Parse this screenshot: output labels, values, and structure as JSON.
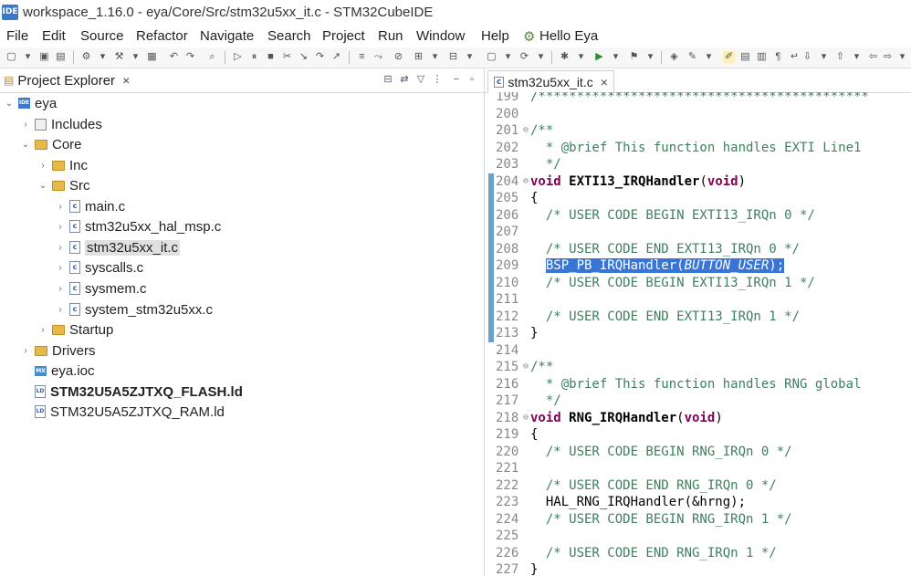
{
  "window": {
    "badge": "IDE",
    "title": "workspace_1.16.0 - eya/Core/Src/stm32u5xx_it.c - STM32CubeIDE"
  },
  "menu": [
    "File",
    "Edit",
    "Source",
    "Refactor",
    "Navigate",
    "Search",
    "Project",
    "Run",
    "Window",
    "Help",
    "Hello Eya"
  ],
  "explorer": {
    "title": "Project Explorer",
    "tree": [
      {
        "label": "eya",
        "twisty": "⌄",
        "icon": "project"
      },
      {
        "label": "Includes",
        "twisty": "›",
        "icon": "includes"
      },
      {
        "label": "Core",
        "twisty": "⌄",
        "icon": "folder"
      },
      {
        "label": "Inc",
        "twisty": "›",
        "icon": "folder"
      },
      {
        "label": "Src",
        "twisty": "⌄",
        "icon": "folder"
      },
      {
        "label": "main.c",
        "twisty": "›",
        "icon": "cfile"
      },
      {
        "label": "stm32u5xx_hal_msp.c",
        "twisty": "›",
        "icon": "cfile"
      },
      {
        "label": "stm32u5xx_it.c",
        "twisty": "›",
        "icon": "cfile",
        "selected": true
      },
      {
        "label": "syscalls.c",
        "twisty": "›",
        "icon": "cfile"
      },
      {
        "label": "sysmem.c",
        "twisty": "›",
        "icon": "cfile"
      },
      {
        "label": "system_stm32u5xx.c",
        "twisty": "›",
        "icon": "cfile"
      },
      {
        "label": "Startup",
        "twisty": "›",
        "icon": "folder"
      },
      {
        "label": "Drivers",
        "twisty": "›",
        "icon": "folder"
      },
      {
        "label": "eya.ioc",
        "twisty": "",
        "icon": "mx"
      },
      {
        "label": "STM32U5A5ZJTXQ_FLASH.ld",
        "twisty": "",
        "icon": "ld",
        "bold": true
      },
      {
        "label": "STM32U5A5ZJTXQ_RAM.ld",
        "twisty": "",
        "icon": "ld"
      }
    ]
  },
  "editor": {
    "tab_label": "stm32u5xx_it.c",
    "lines": [
      {
        "n": "199",
        "segs": [
          {
            "t": "/*******************************************",
            "c": "comment"
          }
        ]
      },
      {
        "n": "200",
        "segs": []
      },
      {
        "n": "201",
        "fold": "⊖",
        "segs": [
          {
            "t": "/**",
            "c": "comment"
          }
        ]
      },
      {
        "n": "202",
        "segs": [
          {
            "t": "  * @brief This function handles EXTI Line1",
            "c": "comment"
          }
        ]
      },
      {
        "n": "203",
        "segs": [
          {
            "t": "  */",
            "c": "comment"
          }
        ]
      },
      {
        "n": "204",
        "fold": "⊖",
        "segs": [
          {
            "t": "void",
            "c": "kw"
          },
          {
            "t": " ",
            "c": "plain"
          },
          {
            "t": "EXTI13_IRQHandler",
            "c": "fn"
          },
          {
            "t": "(",
            "c": "plain"
          },
          {
            "t": "void",
            "c": "kw"
          },
          {
            "t": ")",
            "c": "plain"
          }
        ]
      },
      {
        "n": "205",
        "segs": [
          {
            "t": "{",
            "c": "plain"
          }
        ]
      },
      {
        "n": "206",
        "segs": [
          {
            "t": "  /* USER CODE BEGIN EXTI13_IRQn 0 */",
            "c": "comment"
          }
        ]
      },
      {
        "n": "207",
        "segs": []
      },
      {
        "n": "208",
        "segs": [
          {
            "t": "  /* USER CODE END EXTI13_IRQn 0 */",
            "c": "comment"
          }
        ]
      },
      {
        "n": "209",
        "segs": [
          {
            "t": "  ",
            "c": "plain"
          },
          {
            "t": "BSP_PB_IRQHandler(",
            "c": "sel"
          },
          {
            "t": "BUTTON_USER",
            "c": "sel sel-italic"
          },
          {
            "t": ");",
            "c": "sel"
          }
        ]
      },
      {
        "n": "210",
        "segs": [
          {
            "t": "  /* USER CODE BEGIN EXTI13_IRQn 1 */",
            "c": "comment"
          }
        ]
      },
      {
        "n": "211",
        "segs": []
      },
      {
        "n": "212",
        "segs": [
          {
            "t": "  /* USER CODE END EXTI13_IRQn 1 */",
            "c": "comment"
          }
        ]
      },
      {
        "n": "213",
        "segs": [
          {
            "t": "}",
            "c": "plain"
          }
        ]
      },
      {
        "n": "214",
        "segs": []
      },
      {
        "n": "215",
        "fold": "⊖",
        "segs": [
          {
            "t": "/**",
            "c": "comment"
          }
        ]
      },
      {
        "n": "216",
        "segs": [
          {
            "t": "  * @brief This function handles RNG global",
            "c": "comment"
          }
        ]
      },
      {
        "n": "217",
        "segs": [
          {
            "t": "  */",
            "c": "comment"
          }
        ]
      },
      {
        "n": "218",
        "fold": "⊖",
        "segs": [
          {
            "t": "void",
            "c": "kw"
          },
          {
            "t": " ",
            "c": "plain"
          },
          {
            "t": "RNG_IRQHandler",
            "c": "fn"
          },
          {
            "t": "(",
            "c": "plain"
          },
          {
            "t": "void",
            "c": "kw"
          },
          {
            "t": ")",
            "c": "plain"
          }
        ]
      },
      {
        "n": "219",
        "segs": [
          {
            "t": "{",
            "c": "plain"
          }
        ]
      },
      {
        "n": "220",
        "segs": [
          {
            "t": "  /* USER CODE BEGIN RNG_IRQn 0 */",
            "c": "comment"
          }
        ]
      },
      {
        "n": "221",
        "segs": []
      },
      {
        "n": "222",
        "segs": [
          {
            "t": "  /* USER CODE END RNG_IRQn 0 */",
            "c": "comment"
          }
        ]
      },
      {
        "n": "223",
        "segs": [
          {
            "t": "  HAL_RNG_IRQHandler(&hrng);",
            "c": "plain"
          }
        ]
      },
      {
        "n": "224",
        "segs": [
          {
            "t": "  /* USER CODE BEGIN RNG_IRQn 1 */",
            "c": "comment"
          }
        ]
      },
      {
        "n": "225",
        "segs": []
      },
      {
        "n": "226",
        "segs": [
          {
            "t": "  /* USER CODE END RNG_IRQn 1 */",
            "c": "comment"
          }
        ]
      },
      {
        "n": "227",
        "segs": [
          {
            "t": "}",
            "c": "plain"
          }
        ]
      }
    ]
  }
}
